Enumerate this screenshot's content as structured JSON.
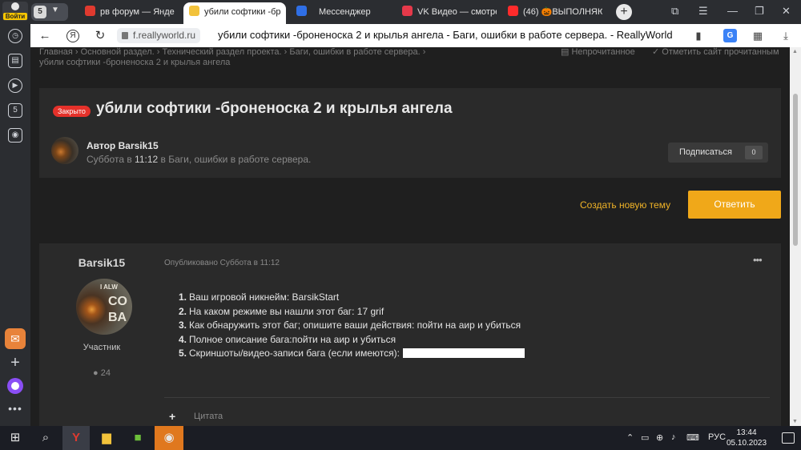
{
  "sidebar": {
    "login_label": "Войти"
  },
  "tabs": {
    "group_count": "5",
    "items": [
      {
        "label": "рв форум — Янде",
        "fav_color": "#e03a2f"
      },
      {
        "label": "убили софтики -бр",
        "fav_color": "#f2c23b"
      },
      {
        "label": "Мессенджер",
        "fav_color": "#2f6fe6"
      },
      {
        "label": "VK Видео — смотре",
        "fav_color": "#e6394a"
      },
      {
        "label": "(46) 🎃ВЫПОЛНЯЮ",
        "fav_color": "#ff2b2b"
      }
    ]
  },
  "addressbar": {
    "domain": "f.reallyworld.ru",
    "page_title": "убили софтики -броненоска 2 и крылья ангела - Баги, ошибки в работе сервера. - ReallyWorld"
  },
  "breadcrumb": {
    "items": [
      "Главная",
      "Основной раздел.",
      "Технический раздел проекта.",
      "Баги, ошибки в работе сервера."
    ],
    "current": "убили софтики -броненоска 2 и крылья ангела",
    "unread": "Непрочитанное",
    "mark_read": "Отметить сайт прочитанным"
  },
  "topic": {
    "badge": "Закрыто",
    "title": "убили софтики -броненоска 2 и крылья ангела",
    "author_label": "Автор Barsik15",
    "meta_prefix": "Суббота в ",
    "meta_time": "11:12",
    "meta_suffix": " в Баги, ошибки в работе сервера.",
    "subscribe_label": "Подписаться",
    "subscribe_count": "0"
  },
  "actions": {
    "new_topic": "Создать новую тему",
    "reply": "Ответить"
  },
  "post": {
    "author": "Barsik15",
    "avatar_text": [
      "I ALW",
      "CO",
      "BA"
    ],
    "role": "Участник",
    "post_count": "24",
    "published": "Опубликовано Суббота в 11:12",
    "menu": "•••",
    "items": [
      {
        "n": "1.",
        "text": "Ваш игровой никнейм: BarsikStart"
      },
      {
        "n": "2.",
        "text": "На каком режиме вы нашли этот баг: 17 grif"
      },
      {
        "n": "3.",
        "text": "Как обнаружить этот баг; опишите ваши действия: пойти на аир и убиться"
      },
      {
        "n": "4.",
        "text": "Полное описание бага:пойти на аир и убиться"
      },
      {
        "n": "5.",
        "text": "Скриншоты/видео-записи бага (если имеются):"
      }
    ],
    "quote_label": "Цитата"
  },
  "taskbar": {
    "lang": "РУС",
    "time": "13:44",
    "date": "05.10.2023"
  },
  "colors": {
    "accent": "#f0a819",
    "closed": "#e5312a",
    "panel": "#2a2a2a",
    "bg": "#1f1f1f"
  }
}
